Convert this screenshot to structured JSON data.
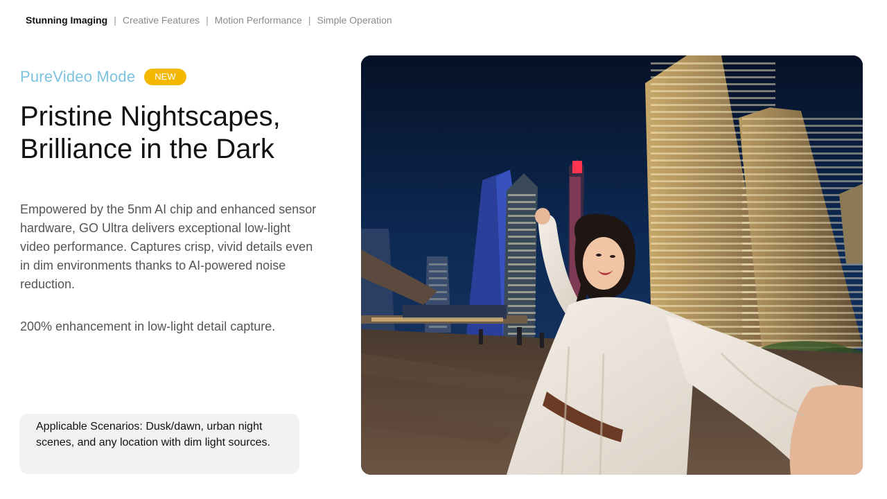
{
  "nav": {
    "tabs": [
      {
        "label": "Stunning Imaging",
        "active": true
      },
      {
        "label": "Creative Features",
        "active": false
      },
      {
        "label": "Motion Performance",
        "active": false
      },
      {
        "label": "Simple Operation",
        "active": false
      }
    ],
    "separator": "|"
  },
  "feature": {
    "mode_label": "PureVideo Mode",
    "badge": "NEW",
    "headline_line1": "Pristine Nightscapes,",
    "headline_line2": "Brilliance in the Dark",
    "description": "Empowered by the 5nm AI chip and enhanced sensor hardware, GO Ultra delivers exceptional low-light video performance. Captures crisp, vivid details even in dim environments thanks to AI-powered noise reduction.",
    "highlight": "200% enhancement in low-light detail capture.",
    "scenarios": "Applicable Scenarios: Dusk/dawn, urban night scenes, and any location with dim light sources."
  },
  "colors": {
    "accent_blue": "#7cc3e0",
    "badge_yellow": "#f5b800",
    "scenario_bg": "#f2f2f4"
  }
}
